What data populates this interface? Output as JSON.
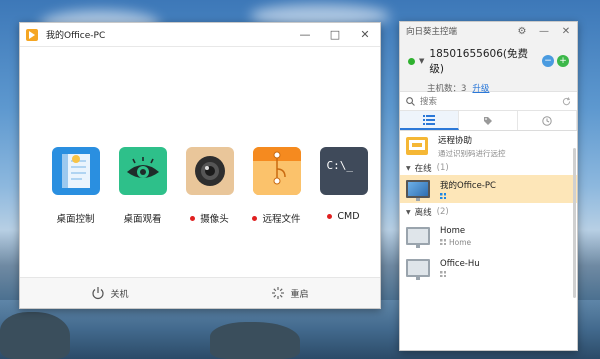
{
  "main_window": {
    "title": "我的Office-PC",
    "controls": {
      "minimize": "—",
      "maximize": "□",
      "close": "✕"
    },
    "tools": [
      {
        "label": "桌面控制",
        "icon": "desktop-control-icon",
        "dot": false,
        "color": "#2a8fe0"
      },
      {
        "label": "桌面观看",
        "icon": "eye-icon",
        "dot": false,
        "color": "#2ec08a"
      },
      {
        "label": "摄像头",
        "icon": "camera-icon",
        "dot": true,
        "color": "#e9c69a"
      },
      {
        "label": "远程文件",
        "icon": "folder-icon",
        "dot": true,
        "color": "#f7a623"
      },
      {
        "label": "CMD",
        "icon": "terminal-icon",
        "dot": true,
        "color": "#3f4a5a"
      }
    ],
    "footer": {
      "shutdown": "关机",
      "restart": "重启"
    },
    "terminal_text": "C:\\_"
  },
  "panel": {
    "title": "向日葵主控端",
    "controls": {
      "settings": "⚙",
      "minimize": "—",
      "close": "✕"
    },
    "account": {
      "phone": "18501655606(免费级)",
      "host_count_label": "主机数：3",
      "upgrade": "升级"
    },
    "search_placeholder": "搜索",
    "assist": {
      "name": "远程协助",
      "sub": "通过识别码进行远控"
    },
    "groups": {
      "online": {
        "label": "在线",
        "count": "(1)"
      },
      "offline": {
        "label": "离线",
        "count": "(2)"
      }
    },
    "devices": [
      {
        "name": "我的Office-PC",
        "sub": "",
        "online": true
      },
      {
        "name": "Home",
        "sub": "Home",
        "online": false
      },
      {
        "name": "Office-Hu",
        "sub": "",
        "online": false
      }
    ]
  }
}
